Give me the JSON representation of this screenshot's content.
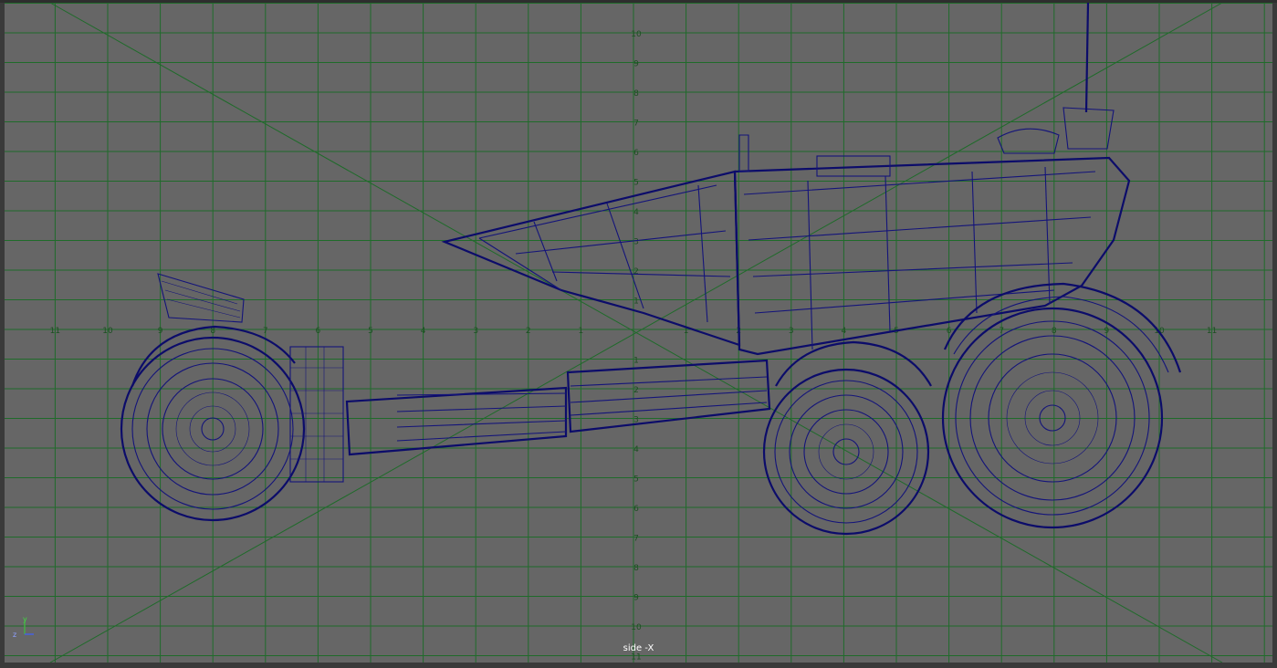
{
  "viewport": {
    "camera_label": "side -X",
    "grid_color": "#1f6b2a",
    "background": "#666666",
    "wireframe_color": "#14147a",
    "x_ticks_left": [
      "11",
      "10",
      "9",
      "8",
      "7",
      "6",
      "5",
      "4",
      "3",
      "2",
      "1"
    ],
    "x_ticks_right": [
      "1",
      "2",
      "3",
      "4",
      "5",
      "6",
      "7",
      "8",
      "9",
      "10",
      "11"
    ],
    "y_ticks_up": [
      "10",
      "9",
      "8",
      "7",
      "6",
      "5",
      "4",
      "3",
      "2",
      "1"
    ],
    "y_ticks_down": [
      "1",
      "2",
      "3",
      "4",
      "5",
      "6",
      "7",
      "8",
      "9",
      "10",
      "11"
    ]
  },
  "axis_indicator": {
    "y_label": "y",
    "z_label": "z"
  }
}
